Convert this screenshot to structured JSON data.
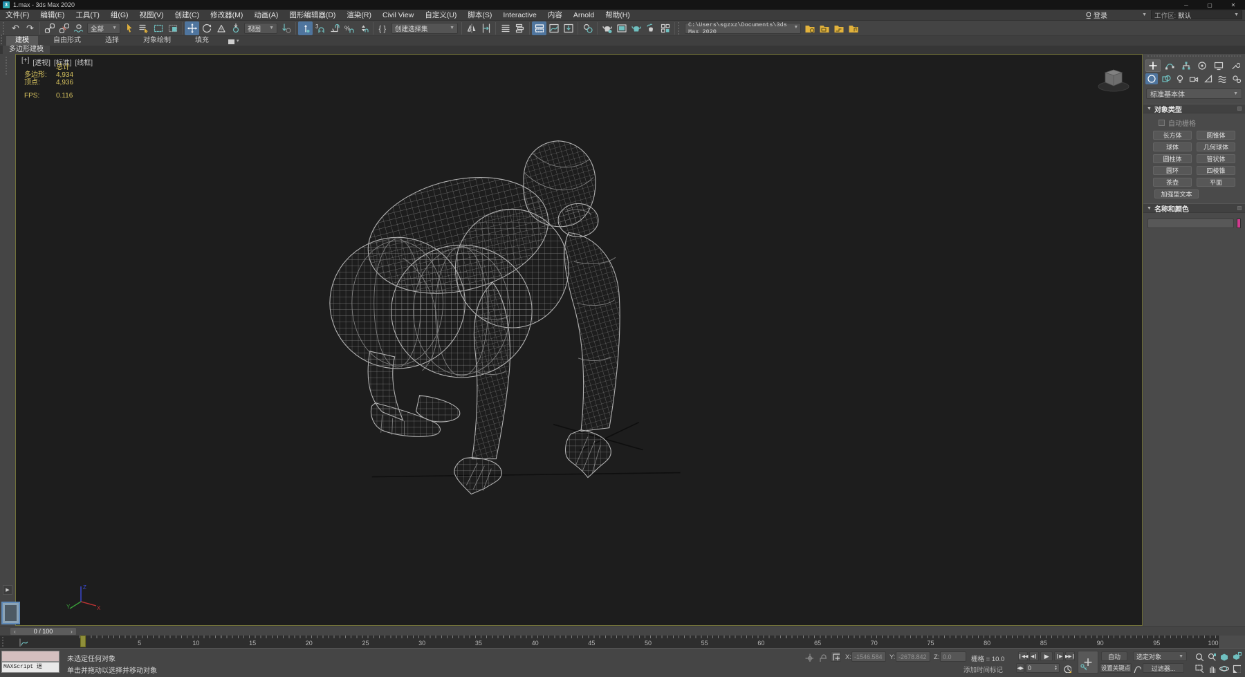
{
  "window": {
    "title": "1.max - 3ds Max 2020",
    "logo_glyph": "3"
  },
  "menu": {
    "items": [
      "文件(F)",
      "编辑(E)",
      "工具(T)",
      "组(G)",
      "视图(V)",
      "创建(C)",
      "修改器(M)",
      "动画(A)",
      "图形编辑器(D)",
      "渲染(R)",
      "Civil View",
      "自定义(U)",
      "脚本(S)",
      "Interactive",
      "内容",
      "Arnold",
      "帮助(H)"
    ],
    "login": "登录",
    "workspace_label": "工作区:",
    "workspace_value": "默认"
  },
  "toolbar": {
    "selection_filter": "全部",
    "reference_coordsys": "视图",
    "named_selection_sets": "创建选择集",
    "project_path": "C:\\Users\\sgzxz\\Documents\\3ds Max 2020"
  },
  "ribbon": {
    "tabs": [
      "建模",
      "自由形式",
      "选择",
      "对象绘制",
      "填充"
    ],
    "active_tab": "建模",
    "panel_label": "多边形建模"
  },
  "viewport": {
    "labels": [
      "[+]",
      "[透视]",
      "[标准]",
      "[线框]"
    ],
    "stats": {
      "total_label": "总计",
      "poly_label": "多边形:",
      "poly_value": "4,934",
      "vertex_label": "顶点:",
      "vertex_value": "4,936",
      "fps_label": "FPS:",
      "fps_value": "0.116"
    }
  },
  "command_panel": {
    "category": "标准基本体",
    "object_type_rollout": "对象类型",
    "autogrid_label": "自动栅格",
    "object_buttons": [
      "长方体",
      "圆锥体",
      "球体",
      "几何球体",
      "圆柱体",
      "管状体",
      "圆环",
      "四棱锥",
      "茶壶",
      "平面",
      "加强型文本"
    ],
    "name_color_rollout": "名称和颜色",
    "object_name_value": "",
    "color_swatch": "#D23A8F"
  },
  "timeline": {
    "slider_value": "0 / 100",
    "tick_labels": [
      "0",
      "5",
      "10",
      "15",
      "20",
      "25",
      "30",
      "35",
      "40",
      "45",
      "50",
      "55",
      "60",
      "65",
      "70",
      "75",
      "80",
      "85",
      "90",
      "95",
      "100"
    ]
  },
  "status_bar": {
    "maxscript_listener": "MAXScript 迷",
    "status_line": "未选定任何对象",
    "prompt_line": "单击并拖动以选择并移动对象",
    "x_label": "X:",
    "x_value": "-1546.584",
    "y_label": "Y:",
    "y_value": "-2678.842",
    "z_label": "Z:",
    "z_value": "0.0",
    "grid_label": "栅格 = 10.0",
    "add_time_tag": "添加时间标记",
    "frame_value": "0",
    "auto_key": "自动",
    "set_key": "设置关键点",
    "selection_set": "选定对象",
    "key_filters": "过滤器..."
  },
  "colors": {
    "accent_teal": "#6FC0C0",
    "accent_yellow": "#E2B23C",
    "active_tool_blue": "#4F759E",
    "stats_yellow": "#D9C45F",
    "name_color_swatch": "#D23A8F",
    "trackbar_thumb": "#8F8F3A",
    "viewport_border": "#7C7C3F"
  }
}
